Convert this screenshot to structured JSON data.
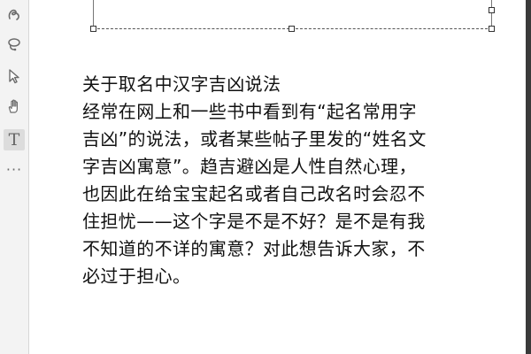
{
  "toolbar": {
    "tools": [
      {
        "id": "curl",
        "icon": "curl-brush-icon"
      },
      {
        "id": "lasso",
        "icon": "lasso-icon"
      },
      {
        "id": "select",
        "icon": "arrow-pointer-icon"
      },
      {
        "id": "hand",
        "icon": "hand-pan-icon"
      },
      {
        "id": "text",
        "icon": "text-tool-icon",
        "glyph": "T",
        "active": true
      },
      {
        "id": "more",
        "icon": "more-dots-icon",
        "glyph": "···"
      }
    ]
  },
  "article": {
    "lines": [
      "关于取名中汉字吉凶说法",
      "经常在网上和一些书中看到有“起名常用字",
      "吉凶”的说法，或者某些帖子里发的“姓名文",
      "字吉凶寓意”。趋吉避凶是人性自然心理，",
      "也因此在给宝宝起名或者自己改名时会忍不",
      "住担忧——这个字是不是不好？是不是有我",
      "不知道的不详的寓意？对此想告诉大家，不",
      "必过于担心。"
    ]
  },
  "colors": {
    "toolbar_bg": "#f3f3f3",
    "text": "#111111",
    "handle_border": "#333333",
    "right_edge": "#3a3a3a"
  }
}
